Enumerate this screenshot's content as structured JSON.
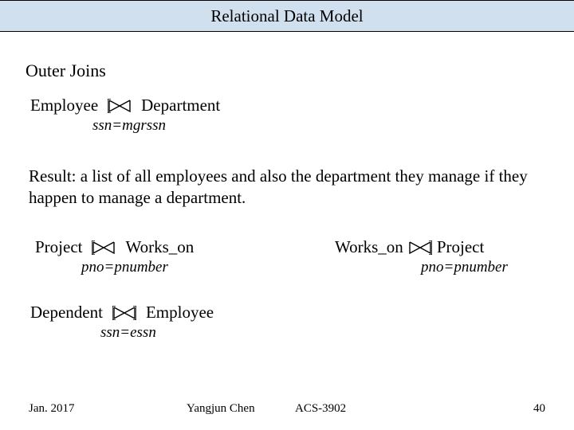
{
  "header": {
    "title": "Relational Data Model"
  },
  "subtitle": "Outer Joins",
  "joins": {
    "j1": {
      "left": "Employee",
      "right": "Department",
      "cond": "ssn=mgrssn"
    },
    "j2": {
      "left": "Project",
      "right": "Works_on",
      "cond": "pno=pnumber"
    },
    "j3": {
      "left": "Works_on",
      "right": "Project",
      "cond": "pno=pnumber"
    },
    "j4": {
      "left": "Dependent",
      "right": "Employee",
      "cond": "ssn=essn"
    }
  },
  "result": "Result: a list of all employees and also the department they manage if they happen to manage a department.",
  "footer": {
    "date": "Jan. 2017",
    "author": "Yangjun Chen",
    "course": "ACS-3902",
    "page": "40"
  }
}
